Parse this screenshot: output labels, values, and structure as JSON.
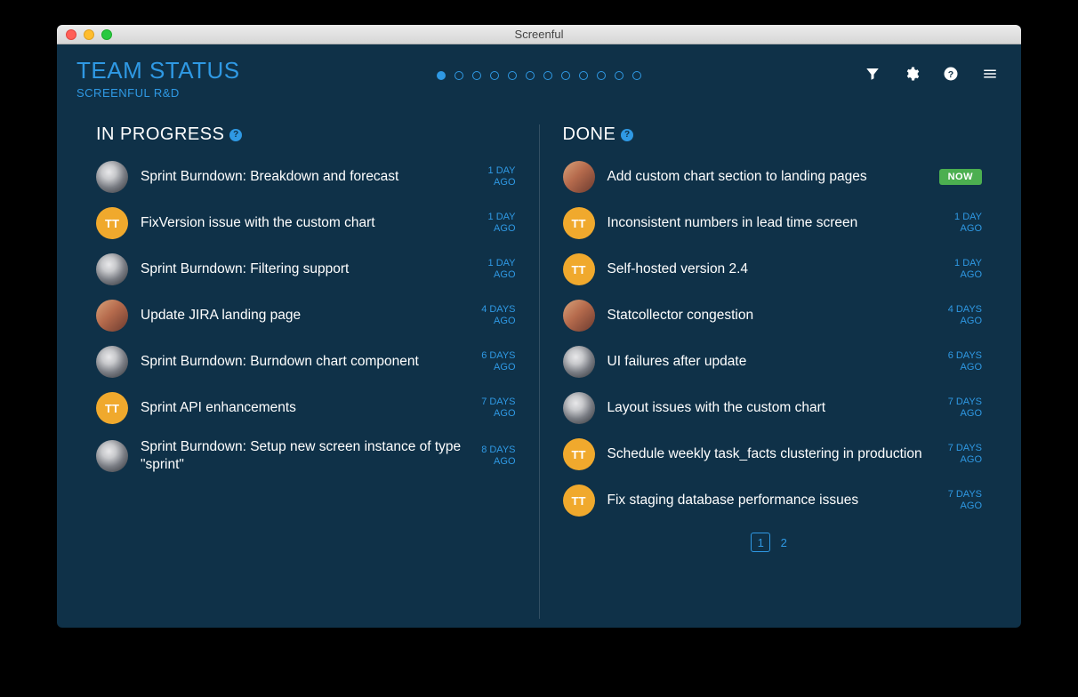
{
  "window_title": "Screenful",
  "header": {
    "title": "TEAM STATUS",
    "subtitle": "SCREENFUL R&D",
    "pager_total": 12,
    "pager_active": 0
  },
  "columns": {
    "in_progress": {
      "title": "IN PROGRESS",
      "items": [
        {
          "avatar": "face1",
          "initials": "",
          "title": "Sprint Burndown: Breakdown and forecast",
          "time": "1 DAY\nAGO"
        },
        {
          "avatar": "tt",
          "initials": "TT",
          "title": "FixVersion issue with the custom chart",
          "time": "1 DAY\nAGO"
        },
        {
          "avatar": "face1",
          "initials": "",
          "title": "Sprint Burndown: Filtering support",
          "time": "1 DAY\nAGO"
        },
        {
          "avatar": "face2",
          "initials": "",
          "title": "Update JIRA landing page",
          "time": "4 DAYS\nAGO"
        },
        {
          "avatar": "face1",
          "initials": "",
          "title": "Sprint Burndown: Burndown chart component",
          "time": "6 DAYS\nAGO"
        },
        {
          "avatar": "tt",
          "initials": "TT",
          "title": "Sprint API enhancements",
          "time": "7 DAYS\nAGO"
        },
        {
          "avatar": "face1",
          "initials": "",
          "title": "Sprint Burndown: Setup new screen instance of type \"sprint\"",
          "time": "8 DAYS\nAGO"
        }
      ]
    },
    "done": {
      "title": "DONE",
      "items": [
        {
          "avatar": "face2",
          "initials": "",
          "title": "Add custom chart section to landing pages",
          "now": true
        },
        {
          "avatar": "tt",
          "initials": "TT",
          "title": "Inconsistent numbers in lead time screen",
          "time": "1 DAY\nAGO"
        },
        {
          "avatar": "tt",
          "initials": "TT",
          "title": "Self-hosted version 2.4",
          "time": "1 DAY\nAGO"
        },
        {
          "avatar": "face2",
          "initials": "",
          "title": "Statcollector congestion",
          "time": "4 DAYS\nAGO"
        },
        {
          "avatar": "face1",
          "initials": "",
          "title": "UI failures after update",
          "time": "6 DAYS\nAGO"
        },
        {
          "avatar": "face1",
          "initials": "",
          "title": "Layout issues with the custom chart",
          "time": "7 DAYS\nAGO"
        },
        {
          "avatar": "tt",
          "initials": "TT",
          "title": "Schedule weekly task_facts clustering in production",
          "time": "7 DAYS\nAGO"
        },
        {
          "avatar": "tt",
          "initials": "TT",
          "title": "Fix staging database performance issues",
          "time": "7 DAYS\nAGO"
        }
      ],
      "pagination": {
        "pages": [
          "1",
          "2"
        ],
        "active": 0
      }
    }
  },
  "labels": {
    "now": "NOW",
    "help": "?"
  }
}
